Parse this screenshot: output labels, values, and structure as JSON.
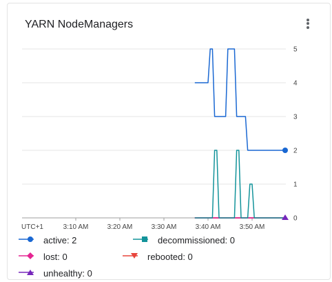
{
  "title": "YARN NodeManagers",
  "menu_icon": "more-vert-icon",
  "chart_data": {
    "type": "line",
    "title": "YARN NodeManagers",
    "x_ticks": [
      "UTC+1",
      "3:10 AM",
      "3:20 AM",
      "3:30 AM",
      "3:40 AM",
      "3:50 AM"
    ],
    "y_ticks": [
      0,
      1,
      2,
      3,
      4,
      5
    ],
    "ylim": [
      0,
      5
    ],
    "grid": true,
    "legend_position": "bottom",
    "series": [
      {
        "name": "active",
        "color": "#1967d2",
        "marker": "circle",
        "points": [
          [
            "3:37",
            4
          ],
          [
            "3:40",
            4
          ],
          [
            "3:40.5",
            5
          ],
          [
            "3:41",
            5
          ],
          [
            "3:41.5",
            3
          ],
          [
            "3:44",
            3
          ],
          [
            "3:44.5",
            5
          ],
          [
            "3:46",
            5
          ],
          [
            "3:46.5",
            3
          ],
          [
            "3:48.5",
            3
          ],
          [
            "3:49",
            2
          ],
          [
            "3:57.5",
            2
          ]
        ]
      },
      {
        "name": "decommissioned",
        "color": "#12939a",
        "marker": "square",
        "points": [
          [
            "3:37",
            0
          ],
          [
            "3:41",
            0
          ],
          [
            "3:41.5",
            2
          ],
          [
            "3:42",
            2
          ],
          [
            "3:42.5",
            0
          ],
          [
            "3:46",
            0
          ],
          [
            "3:46.5",
            2
          ],
          [
            "3:47",
            2
          ],
          [
            "3:47.5",
            0
          ],
          [
            "3:49",
            0
          ],
          [
            "3:49.5",
            1
          ],
          [
            "3:50",
            1
          ],
          [
            "3:50.5",
            0
          ],
          [
            "3:57.5",
            0
          ]
        ]
      },
      {
        "name": "lost",
        "color": "#e52592",
        "marker": "diamond",
        "points": [
          [
            "3:37",
            0
          ],
          [
            "3:57.5",
            0
          ]
        ]
      },
      {
        "name": "rebooted",
        "color": "#e8453c",
        "marker": "triangle-down",
        "points": [
          [
            "3:37",
            0
          ],
          [
            "3:57.5",
            0
          ]
        ]
      },
      {
        "name": "unhealthy",
        "color": "#7627bb",
        "marker": "triangle-up",
        "points": [
          [
            "3:37",
            0
          ],
          [
            "3:57.5",
            0
          ]
        ]
      }
    ]
  },
  "legend": [
    {
      "label": "active: 2",
      "color": "#1967d2",
      "marker": "circle"
    },
    {
      "label": "decommissioned: 0",
      "color": "#12939a",
      "marker": "square"
    },
    {
      "label": "lost: 0",
      "color": "#e52592",
      "marker": "diamond"
    },
    {
      "label": "rebooted: 0",
      "color": "#e8453c",
      "marker": "triangle-down"
    },
    {
      "label": "unhealthy: 0",
      "color": "#7627bb",
      "marker": "triangle-up"
    }
  ]
}
